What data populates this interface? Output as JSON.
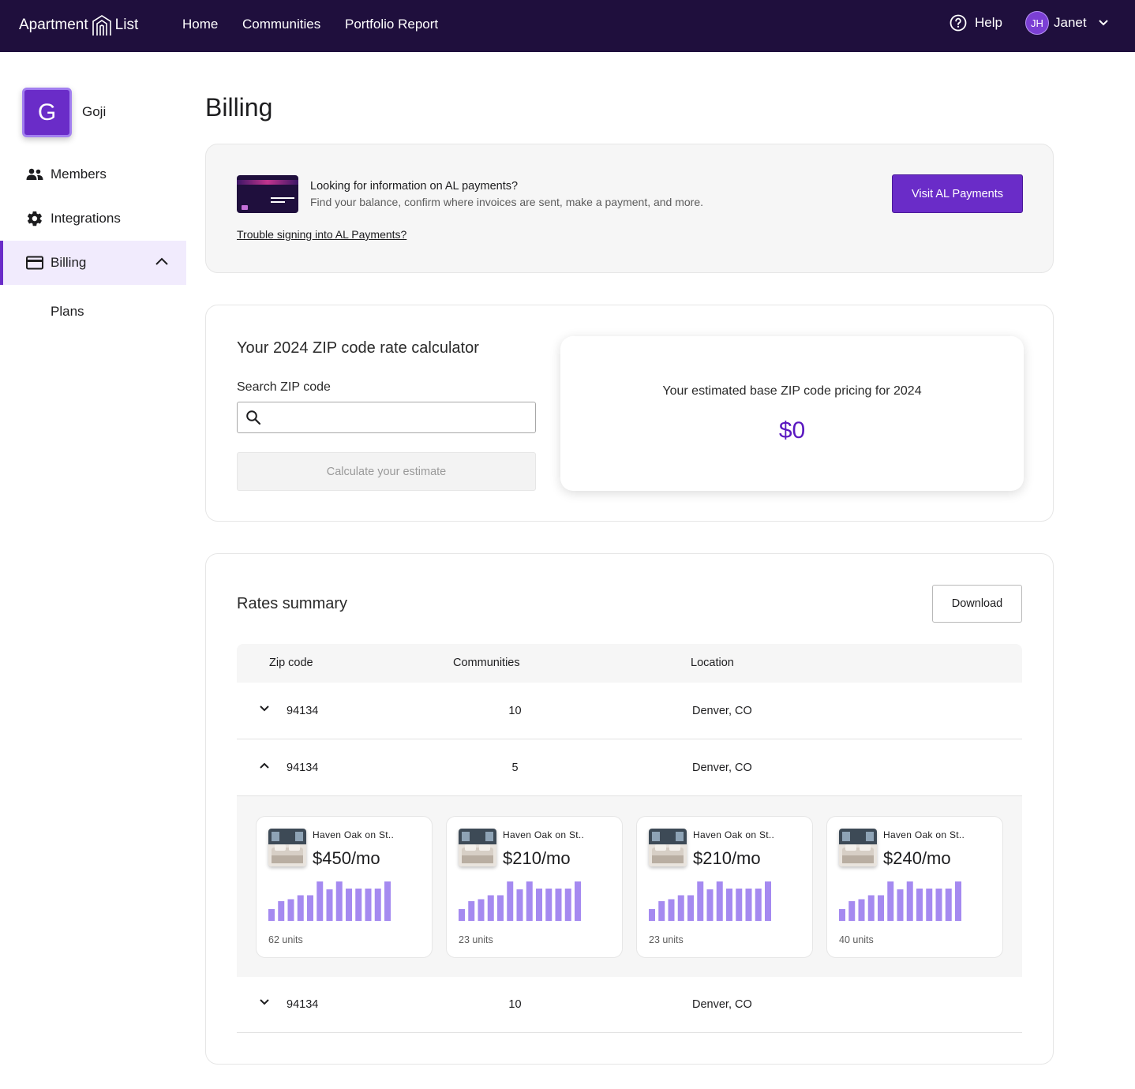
{
  "nav": {
    "logo_left": "Apartment",
    "logo_right": "List",
    "links": [
      "Home",
      "Communities",
      "Portfolio Report"
    ],
    "help": "Help",
    "user_initials": "JH",
    "user_name": "Janet"
  },
  "sidebar": {
    "org_initial": "G",
    "org_name": "Goji",
    "items": [
      {
        "label": "Members",
        "icon": "members-icon"
      },
      {
        "label": "Integrations",
        "icon": "gear-icon"
      },
      {
        "label": "Billing",
        "icon": "credit-card-icon",
        "active": true
      }
    ],
    "sub_items": [
      "Plans"
    ]
  },
  "page": {
    "title": "Billing"
  },
  "payments_info": {
    "title": "Looking for information on AL payments?",
    "description": "Find your balance, confirm where invoices are sent, make a payment, and more.",
    "trouble_link": "Trouble signing into AL Payments?",
    "button": "Visit AL Payments"
  },
  "calculator": {
    "title": "Your 2024 ZIP code rate calculator",
    "search_label": "Search ZIP code",
    "search_value": "",
    "button": "Calculate your estimate",
    "estimate_label": "Your estimated base ZIP code pricing for 2024",
    "estimate_value": "$0"
  },
  "rates": {
    "title": "Rates summary",
    "download": "Download",
    "columns": [
      "Zip code",
      "Communities",
      "Location"
    ],
    "rows": [
      {
        "zip": "94134",
        "communities": "10",
        "location": "Denver, CO",
        "expanded": false
      },
      {
        "zip": "94134",
        "communities": "5",
        "location": "Denver, CO",
        "expanded": true
      },
      {
        "zip": "94134",
        "communities": "10",
        "location": "Denver, CO",
        "expanded": false
      }
    ],
    "community_cards": [
      {
        "name": "Haven Oak on St..",
        "price": "$450/mo",
        "units": "62 units",
        "bars": [
          0.3,
          0.5,
          0.55,
          0.65,
          0.65,
          1.0,
          0.8,
          1.0,
          0.82,
          0.82,
          0.82,
          0.82,
          1.0
        ]
      },
      {
        "name": "Haven Oak on St..",
        "price": "$210/mo",
        "units": "23 units",
        "bars": [
          0.3,
          0.5,
          0.55,
          0.65,
          0.65,
          1.0,
          0.8,
          1.0,
          0.82,
          0.82,
          0.82,
          0.82,
          1.0
        ]
      },
      {
        "name": "Haven Oak on St..",
        "price": "$210/mo",
        "units": "23 units",
        "bars": [
          0.3,
          0.5,
          0.55,
          0.65,
          0.65,
          1.0,
          0.8,
          1.0,
          0.82,
          0.82,
          0.82,
          0.82,
          1.0
        ]
      },
      {
        "name": "Haven Oak on St..",
        "price": "$240/mo",
        "units": "40 units",
        "bars": [
          0.3,
          0.5,
          0.55,
          0.65,
          0.65,
          1.0,
          0.8,
          1.0,
          0.82,
          0.82,
          0.82,
          0.82,
          1.0
        ]
      }
    ]
  },
  "colors": {
    "nav_bg": "#1f0f3d",
    "brand_purple": "#6a2cc8",
    "bar_purple": "#a58af0",
    "active_bg": "#f1ebfd"
  }
}
